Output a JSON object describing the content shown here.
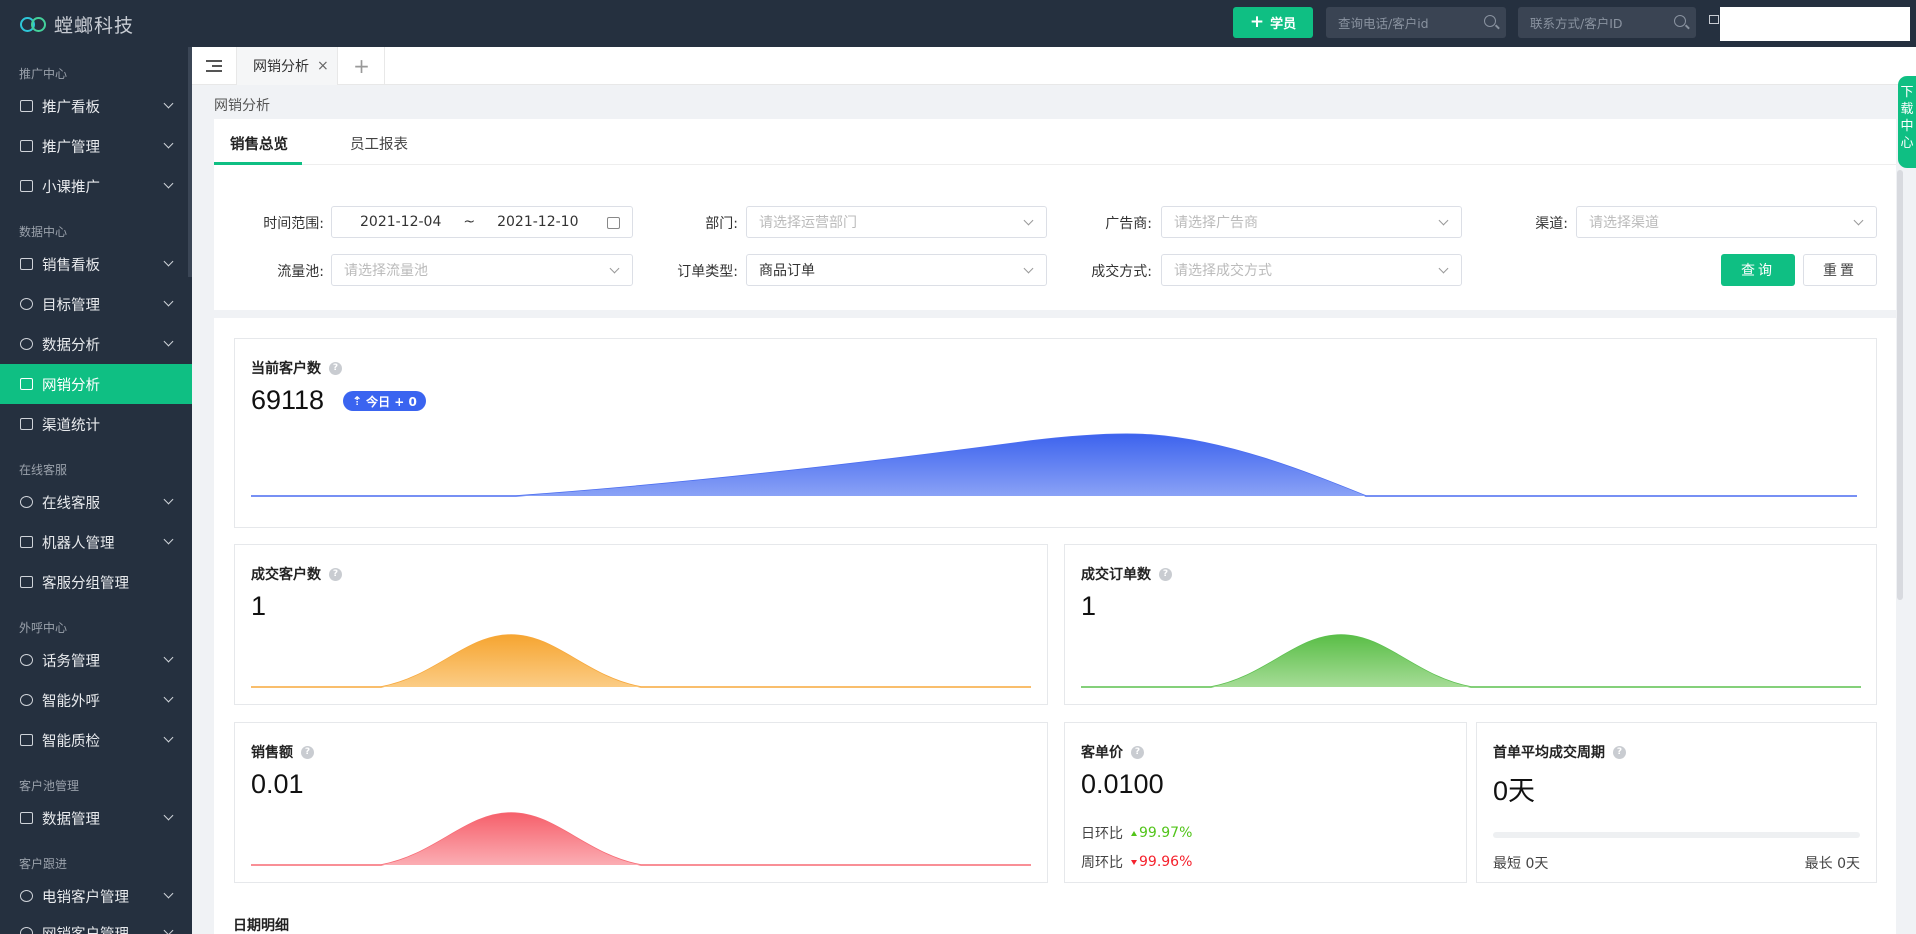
{
  "app": {
    "logo_text": "螳螂科技"
  },
  "topbar": {
    "add_student_label": "学员",
    "search_phone_placeholder": "查询电话/客户id",
    "search_contact_placeholder": "联系方式/客户ID"
  },
  "sidebar": {
    "sections": [
      {
        "title": "推广中心"
      },
      {
        "title": "数据中心"
      },
      {
        "title": "在线客服"
      },
      {
        "title": "外呼中心"
      },
      {
        "title": "客户池管理"
      },
      {
        "title": "客户跟进"
      }
    ],
    "items": [
      {
        "label": "推广看板"
      },
      {
        "label": "推广管理"
      },
      {
        "label": "小课推广"
      },
      {
        "label": "销售看板"
      },
      {
        "label": "目标管理"
      },
      {
        "label": "数据分析"
      },
      {
        "label": "网销分析"
      },
      {
        "label": "渠道统计"
      },
      {
        "label": "在线客服"
      },
      {
        "label": "机器人管理"
      },
      {
        "label": "客服分组管理"
      },
      {
        "label": "话务管理"
      },
      {
        "label": "智能外呼"
      },
      {
        "label": "智能质检"
      },
      {
        "label": "数据管理"
      },
      {
        "label": "电销客户管理"
      },
      {
        "label": "网销客户管理"
      }
    ]
  },
  "tabbar": {
    "tab_label": "网销分析",
    "close": "×",
    "add": "+"
  },
  "breadcrumb": "网销分析",
  "subtabs": [
    {
      "label": "销售总览"
    },
    {
      "label": "员工报表"
    }
  ],
  "filters": {
    "time_label": "时间范围:",
    "date_start": "2021-12-04",
    "date_sep": "~",
    "date_end": "2021-12-10",
    "dept_label": "部门:",
    "dept_placeholder": "请选择运营部门",
    "advertiser_label": "广告商:",
    "advertiser_placeholder": "请选择广告商",
    "channel_label": "渠道:",
    "channel_placeholder": "请选择渠道",
    "pool_label": "流量池:",
    "pool_placeholder": "请选择流量池",
    "order_type_label": "订单类型:",
    "order_type_value": "商品订单",
    "deal_label": "成交方式:",
    "deal_placeholder": "请选择成交方式",
    "query_label": "查询",
    "reset_label": "重置"
  },
  "stats": {
    "current_customers": {
      "title": "当前客户数",
      "value": "69118",
      "badge": "今日 + 0",
      "color": "#4a6cf0"
    },
    "deal_customers": {
      "title": "成交客户数",
      "value": "1",
      "color": "#f7a83b"
    },
    "deal_orders": {
      "title": "成交订单数",
      "value": "1",
      "color": "#5cc04f"
    },
    "sales": {
      "title": "销售额",
      "value": "0.01",
      "color": "#f76a74"
    },
    "unit_price": {
      "title": "客单价",
      "value": "0.0100",
      "day_label": "日环比",
      "day_value": "99.97%",
      "week_label": "周环比",
      "week_value": "99.96%"
    },
    "first_cycle": {
      "title": "首单平均成交周期",
      "value": "0天",
      "min_label": "最短 0天",
      "max_label": "最长 0天",
      "progress": 0
    }
  },
  "bottom_title": "日期明细",
  "download_center": "下载中心",
  "help_glyph": "?"
}
